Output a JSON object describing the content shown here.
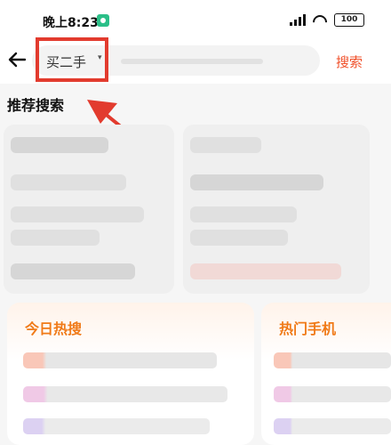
{
  "status_bar": {
    "time": "晚上8:23",
    "battery": "100"
  },
  "search": {
    "category_label": "买二手",
    "category_caret": "▾",
    "button_label": "搜索"
  },
  "section": {
    "recommended_title": "推荐搜索"
  },
  "rank_cards": [
    {
      "title": "今日热搜"
    },
    {
      "title": "热门手机"
    }
  ],
  "colors": {
    "accent": "#f0502a",
    "highlight": "#e23b2e",
    "rank_title": "#f07a18"
  }
}
